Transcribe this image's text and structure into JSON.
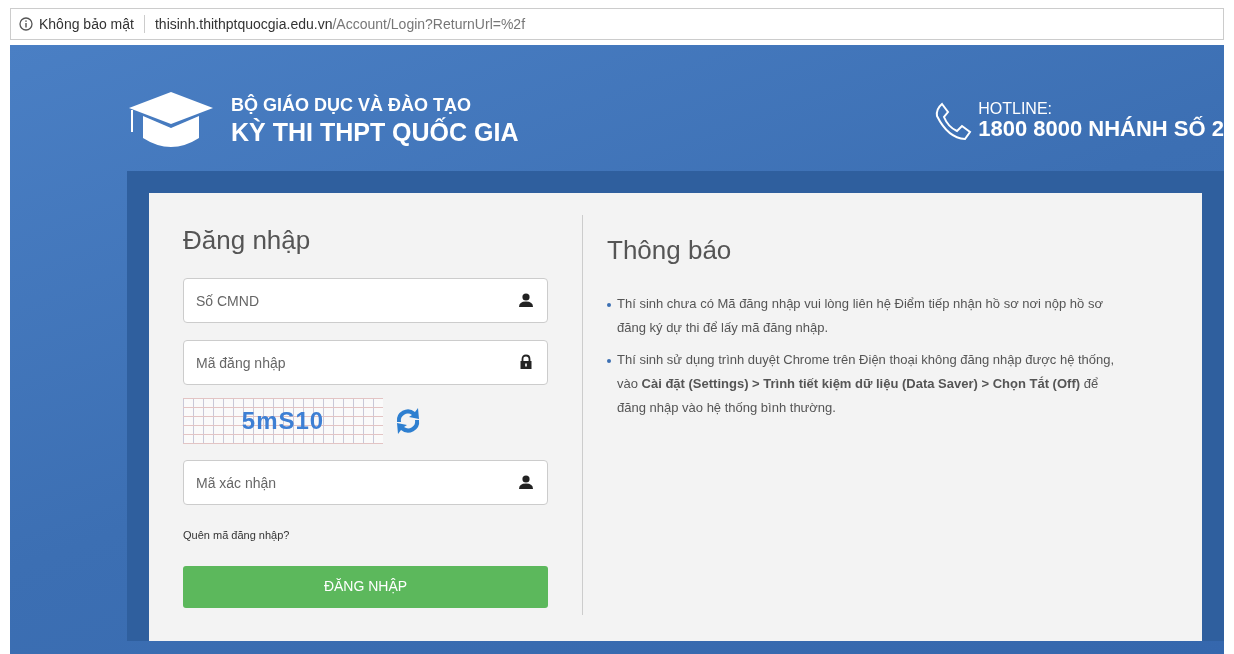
{
  "address_bar": {
    "security": "Không bảo mật",
    "domain": "thisinh.thithptquocgia.edu.vn",
    "path": "/Account/Login?ReturnUrl=%2f"
  },
  "header": {
    "line_1": "BỘ GIÁO DỤC VÀ ĐÀO TẠO",
    "line_2": "KỲ THI THPT QUỐC GIA",
    "hotline_label": "HOTLINE:",
    "hotline_number": "1800 8000 NHÁNH SỐ 2"
  },
  "login": {
    "title": "Đăng nhập",
    "fields": [
      {
        "placeholder": "Số CMND",
        "kind": "user"
      },
      {
        "placeholder": "Mã đăng nhập",
        "kind": "lock"
      }
    ],
    "captcha": {
      "text": "5mS10"
    },
    "captcha_field": {
      "placeholder": "Mã xác nhận",
      "kind": "user"
    },
    "forgot_link": "Quên mã đăng nhập?",
    "submit": "ĐĂNG NHẬP"
  },
  "notice": {
    "title": "Thông báo",
    "items": [
      "Thí sinh chưa có Mã đăng nhập vui lòng liên hệ Điểm tiếp nhận hồ sơ nơi nộp hồ sơ đăng ký dự thi để lấy mã đăng nhập.",
      "Thí sinh sử dụng trình duyệt Chrome trên Điện thoại không đăng nhập được hệ thống, vào **Cài đặt (Settings) > Trình tiết kiệm dữ liệu (Data Saver) > Chọn Tắt (Off)** để đăng nhập vào hệ thống bình thường."
    ]
  }
}
